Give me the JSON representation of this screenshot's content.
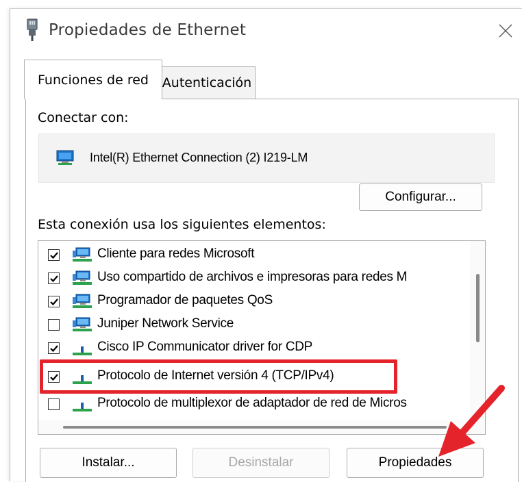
{
  "window": {
    "title": "Propiedades de Ethernet"
  },
  "tabs": [
    {
      "label": "Funciones de red",
      "active": true
    },
    {
      "label": "Autenticación",
      "active": false
    }
  ],
  "connect": {
    "label": "Conectar con:",
    "adapter_name": "Intel(R) Ethernet Connection (2) I219-LM",
    "configure_label": "Configurar..."
  },
  "elements": {
    "label": "Esta conexión usa los siguientes elementos:",
    "items": [
      {
        "label": "Cliente para redes Microsoft",
        "checked": true,
        "icon": "network-client-icon"
      },
      {
        "label": "Uso compartido de archivos e impresoras para redes M",
        "checked": true,
        "icon": "network-service-icon"
      },
      {
        "label": "Programador de paquetes QoS",
        "checked": true,
        "icon": "network-service-icon"
      },
      {
        "label": "Juniper Network Service",
        "checked": false,
        "icon": "network-service-icon"
      },
      {
        "label": "Cisco IP Communicator driver for CDP",
        "checked": true,
        "icon": "protocol-icon"
      },
      {
        "label": "Protocolo de Internet versión 4 (TCP/IPv4)",
        "checked": true,
        "icon": "protocol-icon"
      },
      {
        "label": "Protocolo de multiplexor de adaptador de red de Micros",
        "checked": false,
        "icon": "protocol-icon"
      }
    ]
  },
  "buttons": {
    "install": "Instalar...",
    "uninstall": "Desinstalar",
    "properties": "Propiedades"
  },
  "colors": {
    "highlight": "#e5232b",
    "arrow": "#e5232b"
  }
}
